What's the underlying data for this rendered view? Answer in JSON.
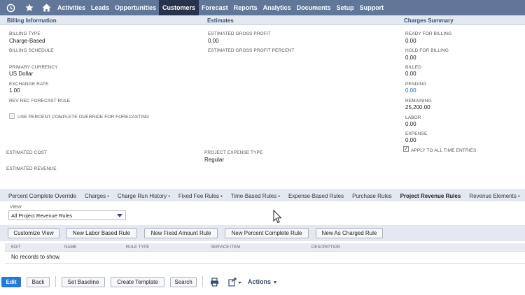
{
  "nav": {
    "items": [
      "Activities",
      "Leads",
      "Opportunities",
      "Customers",
      "Forecast",
      "Reports",
      "Analytics",
      "Documents",
      "Setup",
      "Support"
    ],
    "active": "Customers"
  },
  "sections": {
    "billing": "Billing Information",
    "estimates": "Estimates",
    "charges": "Charges Summary"
  },
  "billing": {
    "billing_type_label": "BILLING TYPE",
    "billing_type_value": "Charge-Based",
    "billing_schedule_label": "BILLING SCHEDULE",
    "primary_currency_label": "PRIMARY CURRENCY",
    "primary_currency_value": "US Dollar",
    "exchange_rate_label": "EXCHANGE RATE",
    "exchange_rate_value": "1.00",
    "rev_rec_label": "REV REC FORECAST RULE",
    "percent_override_label": "USE PERCENT COMPLETE OVERRIDE FOR FORECASTING"
  },
  "estimates": {
    "gross_profit_label": "ESTIMATED GROSS PROFIT",
    "gross_profit_value": "0.00",
    "gross_profit_percent_label": "ESTIMATED GROSS PROFIT PERCENT"
  },
  "charges": {
    "ready_label": "READY FOR BILLING",
    "ready_value": "0.00",
    "hold_label": "HOLD FOR BILLING",
    "hold_value": "0.00",
    "billed_label": "BILLED",
    "billed_value": "0.00",
    "pending_label": "PENDING",
    "pending_value": "0.00",
    "remaining_label": "REMAINING",
    "remaining_value": "25,200.00",
    "labor_label": "LABOR",
    "labor_value": "0.00",
    "expense_label": "EXPENSE",
    "expense_value": "0.00",
    "apply_label": "APPLY TO ALL TIME ENTRIES"
  },
  "costs": {
    "estimated_cost_label": "ESTIMATED COST",
    "estimated_revenue_label": "ESTIMATED REVENUE",
    "expense_type_label": "PROJECT EXPENSE TYPE",
    "expense_type_value": "Regular"
  },
  "tabs": [
    {
      "label": "Percent Complete Override",
      "dot": false
    },
    {
      "label": "Charges",
      "dot": true
    },
    {
      "label": "Charge Run History",
      "dot": true
    },
    {
      "label": "Fixed Fee Rules",
      "dot": true
    },
    {
      "label": "Time-Based Rules",
      "dot": true
    },
    {
      "label": "Expense-Based Rules",
      "dot": false
    },
    {
      "label": "Purchase Rules",
      "dot": false
    },
    {
      "label": "Project Revenue Rules",
      "dot": false
    },
    {
      "label": "Revenue Elements",
      "dot": true
    }
  ],
  "active_tab": "Project Revenue Rules",
  "view": {
    "label": "VIEW",
    "selected": "All Project Revenue Rules"
  },
  "action_buttons": {
    "customize": "Customize View",
    "labor": "New Labor Based Rule",
    "fixed": "New Fixed Amount Rule",
    "percent": "New Percent Complete Rule",
    "charged": "New As Charged Rule"
  },
  "columns": {
    "edit": "EDIT",
    "name": "NAME",
    "rule_type": "RULE TYPE",
    "service_item": "SERVICE ITEM",
    "description": "DESCRIPTION"
  },
  "empty_message": "No records to show.",
  "bottom": {
    "edit": "Edit",
    "back": "Back",
    "set_baseline": "Set Baseline",
    "create_template": "Create Template",
    "search": "Search",
    "actions": "Actions"
  },
  "icons": [
    "recent-records-icon",
    "star-icon",
    "home-icon",
    "print-icon",
    "export-icon",
    "caret-down-icon"
  ],
  "colors": {
    "nav_bg": "#607799",
    "nav_active": "#26334a",
    "edit_button": "#1f7ae0",
    "link": "#3366aa"
  }
}
